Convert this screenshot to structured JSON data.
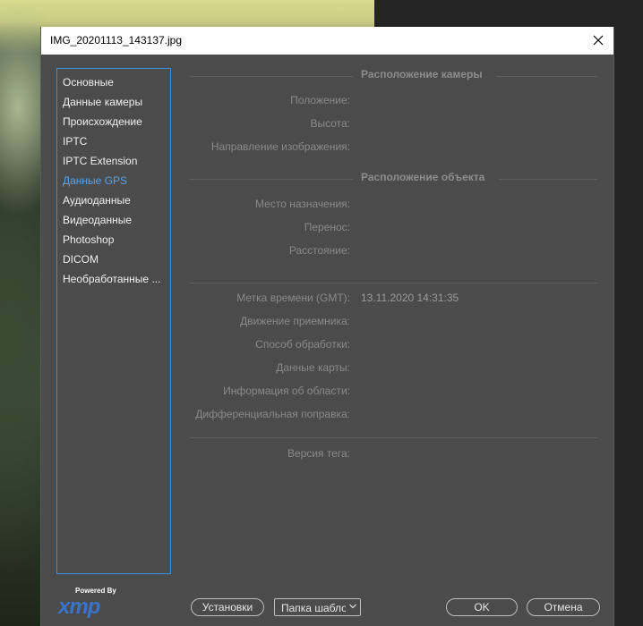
{
  "window": {
    "title": "IMG_20201113_143137.jpg"
  },
  "sidebar": {
    "items": [
      {
        "label": "Основные"
      },
      {
        "label": "Данные камеры"
      },
      {
        "label": "Происхождение"
      },
      {
        "label": "IPTC"
      },
      {
        "label": "IPTC Extension"
      },
      {
        "label": "Данные GPS",
        "active": true
      },
      {
        "label": "Аудиоданные"
      },
      {
        "label": "Видеоданные"
      },
      {
        "label": "Photoshop"
      },
      {
        "label": "DICOM"
      },
      {
        "label": "Необработанные ..."
      }
    ]
  },
  "camera_location": {
    "heading": "Расположение камеры",
    "position_label": "Положение:",
    "altitude_label": "Высота:",
    "image_direction_label": "Направление изображения:"
  },
  "subject_location": {
    "heading": "Расположение объекта",
    "destination_label": "Место назначения:",
    "bearing_label": "Перенос:",
    "distance_label": "Расстояние:"
  },
  "misc": {
    "timestamp_label": "Метка времени (GMT):",
    "timestamp_value": "13.11.2020 14:31:35",
    "receiver_motion_label": "Движение приемника:",
    "processing_method_label": "Способ обработки:",
    "map_datum_label": "Данные карты:",
    "area_info_label": "Информация об области:",
    "differential_label": "Дифференциальная поправка:",
    "tag_version_label": "Версия тега:"
  },
  "footer": {
    "powered_by": "Powered By",
    "xmp_logo": "xmp",
    "settings_button": "Установки",
    "template_folder": "Папка шаблонов",
    "ok_button": "OK",
    "cancel_button": "Отмена"
  },
  "colors": {
    "dialog_bg": "#4b4b4b",
    "accent": "#3f8fd6",
    "active_item": "#56a3e8",
    "xmp_blue": "#3a74c9"
  },
  "icons": {
    "close": "close-icon",
    "dropdown": "chevron-down-icon"
  }
}
